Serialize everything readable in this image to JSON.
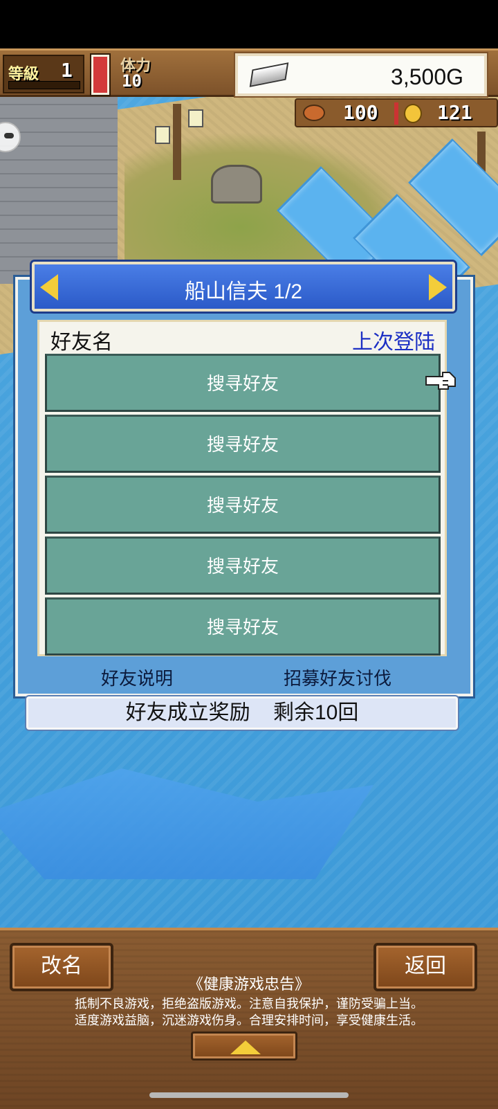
{
  "hud": {
    "level_label": "等級",
    "level_value": "1",
    "stamina_label": "体力",
    "stamina_value": "10",
    "gold": "3,500G",
    "food": "100",
    "coins": "121"
  },
  "friends_panel": {
    "title": "船山信夫 1/2",
    "col_name": "好友名",
    "col_last_login": "上次登陆",
    "slots": [
      "搜寻好友",
      "搜寻好友",
      "搜寻好友",
      "搜寻好友",
      "搜寻好友"
    ],
    "help_link": "好友说明",
    "recruit_link": "招募好友讨伐",
    "reward": "好友成立奖励    剩余10回"
  },
  "bottom": {
    "rename_label": "改名",
    "back_label": "返回",
    "notice_title": "《健康游戏忠告》",
    "notice_line1": "抵制不良游戏，拒绝盗版游戏。注意自我保护，谨防受骗上当。",
    "notice_line2": "适度游戏益脑，沉迷游戏伤身。合理安排时间，享受健康生活。"
  },
  "colors": {
    "panel_blue": "#5d9fd8",
    "slot_teal": "#69a497",
    "header_blue": "#2b5ac8",
    "wood": "#7d522a",
    "login_link": "#1c2fc4"
  },
  "icons": [
    "gold-bar-icon",
    "food-icon",
    "coin-icon",
    "prev-arrow-icon",
    "next-arrow-icon",
    "pointer-hand-icon",
    "expand-up-icon"
  ]
}
